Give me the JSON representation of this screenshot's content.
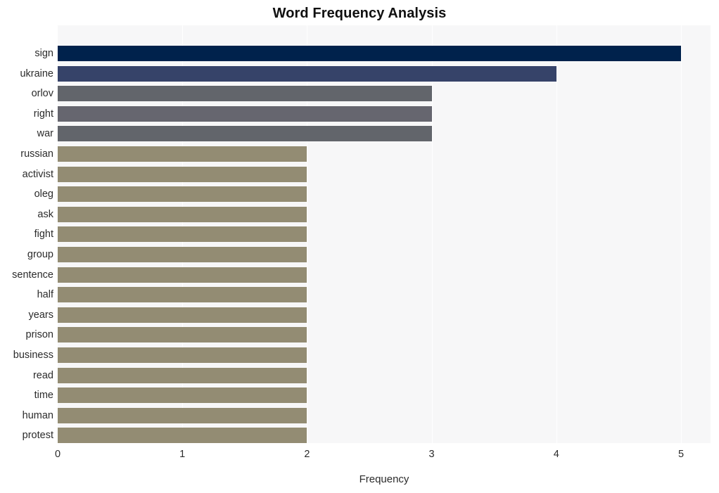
{
  "chart_data": {
    "type": "bar",
    "orientation": "horizontal",
    "title": "Word Frequency Analysis",
    "xlabel": "Frequency",
    "ylabel": "",
    "xlim": [
      0,
      5
    ],
    "xticks": [
      0,
      1,
      2,
      3,
      4,
      5
    ],
    "xtick_labels": [
      "0",
      "1",
      "2",
      "3",
      "4",
      "5"
    ],
    "grid": "vertical-white",
    "legend": "none",
    "categories": [
      "sign",
      "ukraine",
      "orlov",
      "right",
      "war",
      "russian",
      "activist",
      "oleg",
      "ask",
      "fight",
      "group",
      "sentence",
      "half",
      "years",
      "prison",
      "business",
      "read",
      "time",
      "human",
      "protest"
    ],
    "values": [
      5,
      4,
      3,
      3,
      3,
      2,
      2,
      2,
      2,
      2,
      2,
      2,
      2,
      2,
      2,
      2,
      2,
      2,
      2,
      2
    ],
    "bar_colors": [
      "#00224c",
      "#364369",
      "#62656b",
      "#66666f",
      "#62656b",
      "#938c73",
      "#938c73",
      "#938c73",
      "#938c73",
      "#938c73",
      "#938c73",
      "#938c73",
      "#938c73",
      "#938c73",
      "#938c73",
      "#938c73",
      "#938c73",
      "#938c73",
      "#938c73",
      "#938c73"
    ]
  },
  "style": {
    "plot_background": "#f7f7f8",
    "figure_background": "#ffffff",
    "gridline_color": "#ffffff",
    "text_color": "#2b2b2b",
    "title_color": "#101010"
  }
}
